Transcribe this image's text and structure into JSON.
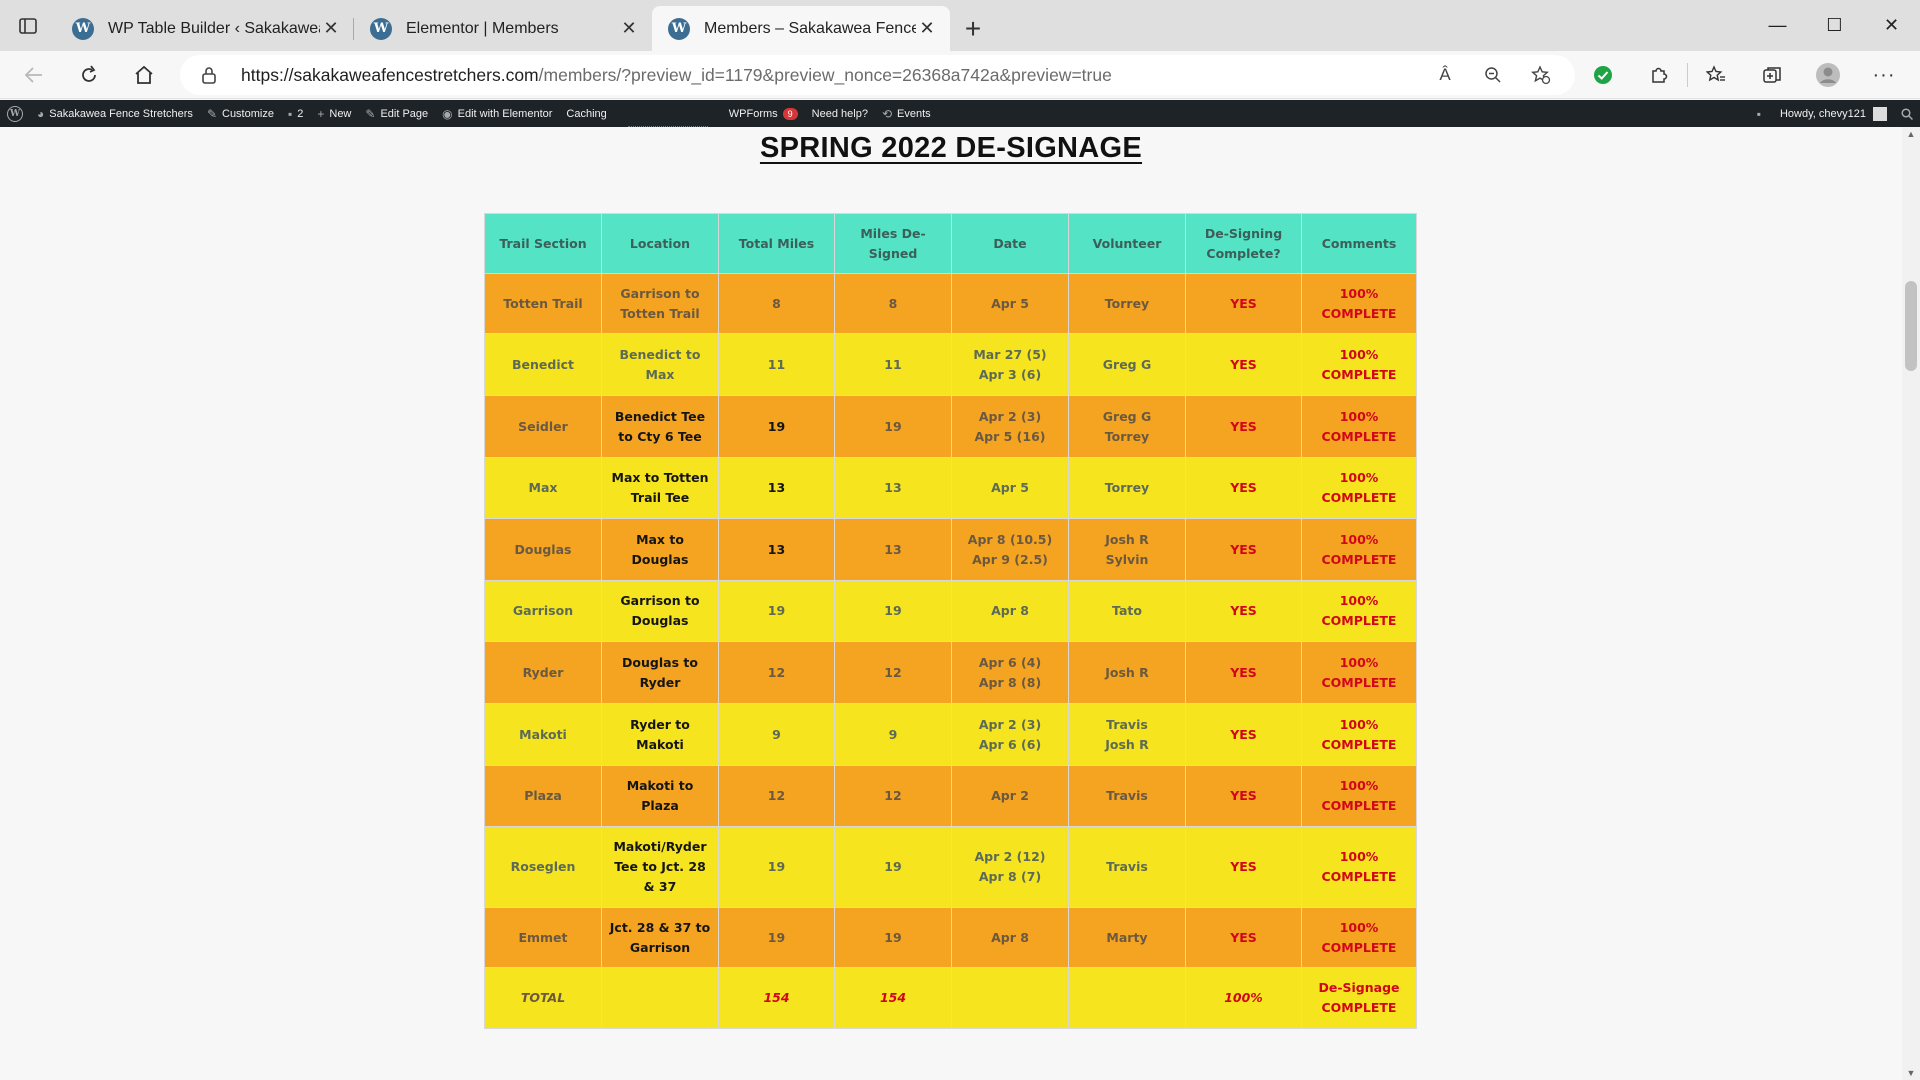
{
  "browser": {
    "tabs": [
      {
        "title": "WP Table Builder ‹ Sakakawea Fe",
        "active": false
      },
      {
        "title": "Elementor | Members",
        "active": false
      },
      {
        "title": "Members – Sakakawea Fence Str",
        "active": true
      }
    ],
    "url_host": "https://sakakaweafencestretchers.com",
    "url_path": "/members/?preview_id=1179&preview_nonce=26368a742a&preview=true",
    "reader_icon_text": "Â"
  },
  "adminbar": {
    "site_name": "Sakakawea Fence Stretchers",
    "customize": "Customize",
    "comments_count": "2",
    "new": "New",
    "edit_page": "Edit Page",
    "edit_elementor": "Edit with Elementor",
    "caching": "Caching",
    "wpforms": "WPForms",
    "wpforms_badge": "9",
    "need_help": "Need help?",
    "events": "Events",
    "howdy": "Howdy, chevy121"
  },
  "page": {
    "title": "SPRING 2022 DE-SIGNAGE",
    "headers": [
      "Trail Section",
      "Location",
      "Total Miles",
      "Miles De-Signed",
      "Date",
      "Volunteer",
      "De-Signing Complete?",
      "Comments"
    ],
    "rows": [
      {
        "section": "Totten Trail",
        "location": "Garrison to Totten Trail",
        "total": "8",
        "designed": "8",
        "date": "Apr 5",
        "volunteer": "Torrey",
        "complete": "YES",
        "comment": "100% COMPLETE"
      },
      {
        "section": "Benedict",
        "location": "Benedict to Max",
        "total": "11",
        "designed": "11",
        "date": "Mar 27 (5)\nApr 3 (6)",
        "volunteer": "Greg G",
        "complete": "YES",
        "comment": "100% COMPLETE"
      },
      {
        "section": "Seidler",
        "location": "Benedict Tee to Cty 6 Tee",
        "total": "19",
        "designed": "19",
        "date": "Apr 2 (3)\nApr 5 (16)",
        "volunteer": "Greg G\nTorrey",
        "complete": "YES",
        "comment": "100% COMPLETE"
      },
      {
        "section": "Max",
        "location": "Max to Totten Trail Tee",
        "total": "13",
        "designed": "13",
        "date": "Apr 5",
        "volunteer": "Torrey",
        "complete": "YES",
        "comment": "100% COMPLETE"
      },
      {
        "section": "Douglas",
        "location": "Max to Douglas",
        "total": "13",
        "designed": "13",
        "date": "Apr 8 (10.5)\nApr 9 (2.5)",
        "volunteer": "Josh R\nSylvin",
        "complete": "YES",
        "comment": "100% COMPLETE"
      },
      {
        "section": "Garrison",
        "location": "Garrison to Douglas",
        "total": "19",
        "designed": "19",
        "date": "Apr 8",
        "volunteer": "Tato",
        "complete": "YES",
        "comment": "100% COMPLETE"
      },
      {
        "section": "Ryder",
        "location": "Douglas to Ryder",
        "total": "12",
        "designed": "12",
        "date": "Apr 6 (4)\nApr 8 (8)",
        "volunteer": "Josh R",
        "complete": "YES",
        "comment": "100% COMPLETE"
      },
      {
        "section": "Makoti",
        "location": "Ryder to Makoti",
        "total": "9",
        "designed": "9",
        "date": "Apr 2 (3)\nApr 6 (6)",
        "volunteer": "Travis\nJosh R",
        "complete": "YES",
        "comment": "100% COMPLETE"
      },
      {
        "section": "Plaza",
        "location": "Makoti to Plaza",
        "total": "12",
        "designed": "12",
        "date": "Apr 2",
        "volunteer": "Travis",
        "complete": "YES",
        "comment": "100% COMPLETE"
      },
      {
        "section": "Roseglen",
        "location": "Makoti/Ryder Tee to Jct. 28 & 37",
        "total": "19",
        "designed": "19",
        "date": "Apr 2 (12)\nApr 8 (7)",
        "volunteer": "Travis",
        "complete": "YES",
        "comment": "100% COMPLETE"
      },
      {
        "section": "Emmet",
        "location": "Jct. 28 & 37 to Garrison",
        "total": "19",
        "designed": "19",
        "date": "Apr 8",
        "volunteer": "Marty",
        "complete": "YES",
        "comment": "100% COMPLETE"
      }
    ],
    "total_row": {
      "section": "TOTAL",
      "location": "",
      "total": "154",
      "designed": "154",
      "date": "",
      "volunteer": "",
      "complete": "100%",
      "comment": "De-Signage COMPLETE"
    }
  },
  "colors": {
    "header_bg": "#54e3c5",
    "row_orange": "#f5a422",
    "row_yellow": "#f6e51e",
    "status_red": "#d1061b",
    "adminbar_bg": "#1d2327"
  }
}
